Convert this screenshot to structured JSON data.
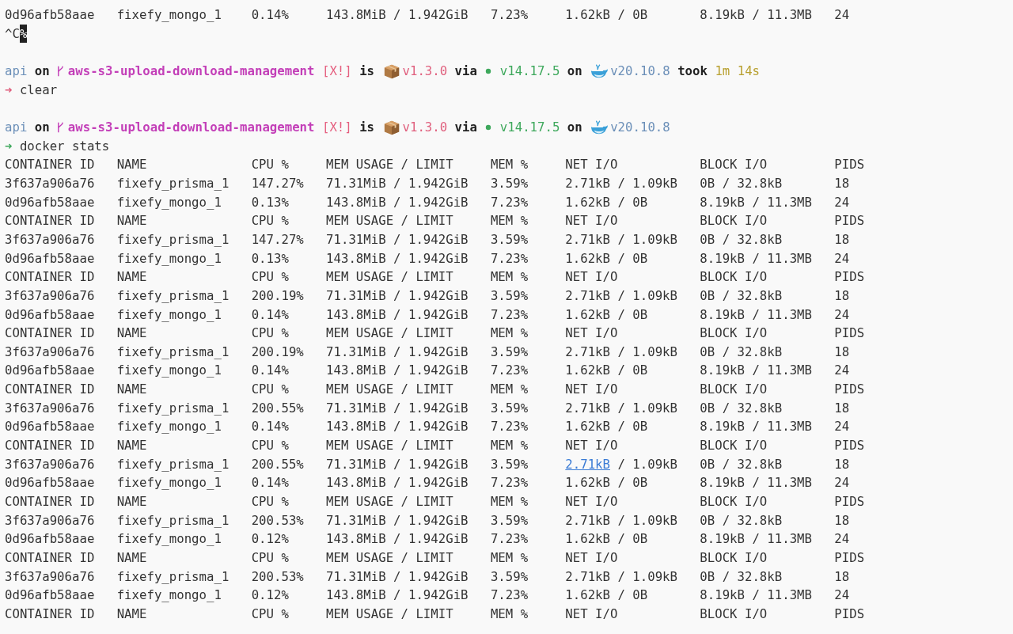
{
  "lines": [
    {
      "kind": "row",
      "cells": [
        "0d96afb58aae",
        "fixefy_mongo_1",
        "0.14%",
        "143.8MiB / 1.942GiB",
        "7.23%",
        "1.62kB / 0B",
        "8.19kB / 11.3MB",
        "24"
      ]
    },
    {
      "kind": "interrupt",
      "text": "^C",
      "cursor": "%"
    },
    {
      "kind": "blank"
    },
    {
      "kind": "prompt",
      "segments": [
        {
          "kind": "dir",
          "text": "api"
        },
        {
          "kind": "word",
          "text": "on"
        },
        {
          "kind": "branch",
          "text": "aws-s3-upload-download-management"
        },
        {
          "kind": "status",
          "text": "[X!]"
        },
        {
          "kind": "word",
          "text": "is"
        },
        {
          "kind": "package",
          "text": "v1.3.0"
        },
        {
          "kind": "word",
          "text": "via"
        },
        {
          "kind": "node",
          "text": "v14.17.5"
        },
        {
          "kind": "word",
          "text": "on"
        },
        {
          "kind": "docker",
          "text": "v20.10.8"
        },
        {
          "kind": "word",
          "text": "took"
        },
        {
          "kind": "duration",
          "text": "1m 14s"
        }
      ]
    },
    {
      "kind": "command",
      "success": false,
      "symbol": "➜",
      "text": "clear"
    },
    {
      "kind": "blank"
    },
    {
      "kind": "prompt",
      "segments": [
        {
          "kind": "dir",
          "text": "api"
        },
        {
          "kind": "word",
          "text": "on"
        },
        {
          "kind": "branch",
          "text": "aws-s3-upload-download-management"
        },
        {
          "kind": "status",
          "text": "[X!]"
        },
        {
          "kind": "word",
          "text": "is"
        },
        {
          "kind": "package",
          "text": "v1.3.0"
        },
        {
          "kind": "word",
          "text": "via"
        },
        {
          "kind": "node",
          "text": "v14.17.5"
        },
        {
          "kind": "word",
          "text": "on"
        },
        {
          "kind": "docker",
          "text": "v20.10.8"
        }
      ]
    },
    {
      "kind": "command",
      "success": true,
      "symbol": "➜",
      "text": "docker stats"
    },
    {
      "kind": "header",
      "cells": [
        "CONTAINER ID",
        "NAME",
        "CPU %",
        "MEM USAGE / LIMIT",
        "MEM %",
        "NET I/O",
        "BLOCK I/O",
        "PIDS"
      ]
    },
    {
      "kind": "row",
      "cells": [
        "3f637a906a76",
        "fixefy_prisma_1",
        "147.27%",
        "71.31MiB / 1.942GiB",
        "3.59%",
        "2.71kB / 1.09kB",
        "0B / 32.8kB",
        "18"
      ]
    },
    {
      "kind": "row",
      "cells": [
        "0d96afb58aae",
        "fixefy_mongo_1",
        "0.13%",
        "143.8MiB / 1.942GiB",
        "7.23%",
        "1.62kB / 0B",
        "8.19kB / 11.3MB",
        "24"
      ]
    },
    {
      "kind": "header",
      "cells": [
        "CONTAINER ID",
        "NAME",
        "CPU %",
        "MEM USAGE / LIMIT",
        "MEM %",
        "NET I/O",
        "BLOCK I/O",
        "PIDS"
      ]
    },
    {
      "kind": "row",
      "cells": [
        "3f637a906a76",
        "fixefy_prisma_1",
        "147.27%",
        "71.31MiB / 1.942GiB",
        "3.59%",
        "2.71kB / 1.09kB",
        "0B / 32.8kB",
        "18"
      ]
    },
    {
      "kind": "row",
      "cells": [
        "0d96afb58aae",
        "fixefy_mongo_1",
        "0.13%",
        "143.8MiB / 1.942GiB",
        "7.23%",
        "1.62kB / 0B",
        "8.19kB / 11.3MB",
        "24"
      ]
    },
    {
      "kind": "header",
      "cells": [
        "CONTAINER ID",
        "NAME",
        "CPU %",
        "MEM USAGE / LIMIT",
        "MEM %",
        "NET I/O",
        "BLOCK I/O",
        "PIDS"
      ]
    },
    {
      "kind": "row",
      "cells": [
        "3f637a906a76",
        "fixefy_prisma_1",
        "200.19%",
        "71.31MiB / 1.942GiB",
        "3.59%",
        "2.71kB / 1.09kB",
        "0B / 32.8kB",
        "18"
      ]
    },
    {
      "kind": "row",
      "cells": [
        "0d96afb58aae",
        "fixefy_mongo_1",
        "0.14%",
        "143.8MiB / 1.942GiB",
        "7.23%",
        "1.62kB / 0B",
        "8.19kB / 11.3MB",
        "24"
      ]
    },
    {
      "kind": "header",
      "cells": [
        "CONTAINER ID",
        "NAME",
        "CPU %",
        "MEM USAGE / LIMIT",
        "MEM %",
        "NET I/O",
        "BLOCK I/O",
        "PIDS"
      ]
    },
    {
      "kind": "row",
      "cells": [
        "3f637a906a76",
        "fixefy_prisma_1",
        "200.19%",
        "71.31MiB / 1.942GiB",
        "3.59%",
        "2.71kB / 1.09kB",
        "0B / 32.8kB",
        "18"
      ]
    },
    {
      "kind": "row",
      "cells": [
        "0d96afb58aae",
        "fixefy_mongo_1",
        "0.14%",
        "143.8MiB / 1.942GiB",
        "7.23%",
        "1.62kB / 0B",
        "8.19kB / 11.3MB",
        "24"
      ]
    },
    {
      "kind": "header",
      "cells": [
        "CONTAINER ID",
        "NAME",
        "CPU %",
        "MEM USAGE / LIMIT",
        "MEM %",
        "NET I/O",
        "BLOCK I/O",
        "PIDS"
      ]
    },
    {
      "kind": "row",
      "cells": [
        "3f637a906a76",
        "fixefy_prisma_1",
        "200.55%",
        "71.31MiB / 1.942GiB",
        "3.59%",
        "2.71kB / 1.09kB",
        "0B / 32.8kB",
        "18"
      ]
    },
    {
      "kind": "row",
      "cells": [
        "0d96afb58aae",
        "fixefy_mongo_1",
        "0.14%",
        "143.8MiB / 1.942GiB",
        "7.23%",
        "1.62kB / 0B",
        "8.19kB / 11.3MB",
        "24"
      ]
    },
    {
      "kind": "header",
      "cells": [
        "CONTAINER ID",
        "NAME",
        "CPU %",
        "MEM USAGE / LIMIT",
        "MEM %",
        "NET I/O",
        "BLOCK I/O",
        "PIDS"
      ]
    },
    {
      "kind": "row",
      "cells": [
        "3f637a906a76",
        "fixefy_prisma_1",
        "200.55%",
        "71.31MiB / 1.942GiB",
        "3.59%",
        {
          "link": "2.71kB",
          "text": " / 1.09kB"
        },
        "0B / 32.8kB",
        "18"
      ]
    },
    {
      "kind": "row",
      "cells": [
        "0d96afb58aae",
        "fixefy_mongo_1",
        "0.14%",
        "143.8MiB / 1.942GiB",
        "7.23%",
        "1.62kB / 0B",
        "8.19kB / 11.3MB",
        "24"
      ]
    },
    {
      "kind": "header",
      "cells": [
        "CONTAINER ID",
        "NAME",
        "CPU %",
        "MEM USAGE / LIMIT",
        "MEM %",
        "NET I/O",
        "BLOCK I/O",
        "PIDS"
      ]
    },
    {
      "kind": "row",
      "cells": [
        "3f637a906a76",
        "fixefy_prisma_1",
        "200.53%",
        "71.31MiB / 1.942GiB",
        "3.59%",
        "2.71kB / 1.09kB",
        "0B / 32.8kB",
        "18"
      ]
    },
    {
      "kind": "row",
      "cells": [
        "0d96afb58aae",
        "fixefy_mongo_1",
        "0.12%",
        "143.8MiB / 1.942GiB",
        "7.23%",
        "1.62kB / 0B",
        "8.19kB / 11.3MB",
        "24"
      ]
    },
    {
      "kind": "header",
      "cells": [
        "CONTAINER ID",
        "NAME",
        "CPU %",
        "MEM USAGE / LIMIT",
        "MEM %",
        "NET I/O",
        "BLOCK I/O",
        "PIDS"
      ]
    },
    {
      "kind": "row",
      "cells": [
        "3f637a906a76",
        "fixefy_prisma_1",
        "200.53%",
        "71.31MiB / 1.942GiB",
        "3.59%",
        "2.71kB / 1.09kB",
        "0B / 32.8kB",
        "18"
      ]
    },
    {
      "kind": "row",
      "cells": [
        "0d96afb58aae",
        "fixefy_mongo_1",
        "0.12%",
        "143.8MiB / 1.942GiB",
        "7.23%",
        "1.62kB / 0B",
        "8.19kB / 11.3MB",
        "24"
      ]
    },
    {
      "kind": "header",
      "cells": [
        "CONTAINER ID",
        "NAME",
        "CPU %",
        "MEM USAGE / LIMIT",
        "MEM %",
        "NET I/O",
        "BLOCK I/O",
        "PIDS"
      ]
    }
  ]
}
